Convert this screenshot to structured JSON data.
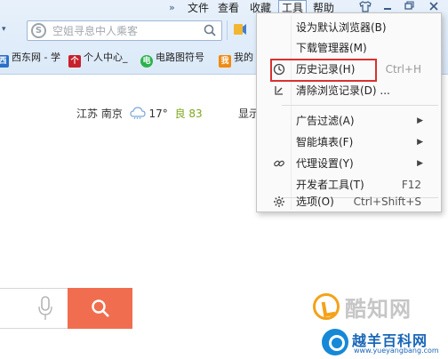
{
  "menubar": {
    "double_arrow": "»",
    "items": [
      "文件",
      "查看",
      "收藏",
      "工具",
      "帮助"
    ],
    "window_buttons": [
      "shirt-icon",
      "minimize-icon",
      "restore-icon",
      "close-icon"
    ]
  },
  "toolbar": {
    "search_placeholder": "空姐寻息中人乘客",
    "left_arrow": "▾"
  },
  "favorites": [
    {
      "label": "西东网 - 学",
      "icon": "xd-icon",
      "color": "#2a6fc9"
    },
    {
      "label": "个人中心_",
      "icon": "person-center-icon",
      "color": "#c8202d"
    },
    {
      "label": "电路图符号",
      "icon": "circuit-icon",
      "color": "#2bb24c"
    },
    {
      "label": "我的",
      "icon": "my-icon",
      "color": "#f08a12"
    }
  ],
  "page": {
    "weather": {
      "location": "江苏 南京",
      "temperature": "17°",
      "aqi_label": "良 83"
    },
    "cut_link": "显示"
  },
  "tools_menu": {
    "items": [
      {
        "label": "设为默认浏览器(B)",
        "shortcut": "",
        "submenu": false,
        "icon": ""
      },
      {
        "label": "下载管理器(M)",
        "shortcut": "",
        "submenu": false,
        "icon": ""
      },
      {
        "label": "历史记录(H)",
        "shortcut": "Ctrl+H",
        "submenu": false,
        "icon": "history-icon"
      },
      {
        "label": "清除浏览记录(D) ...",
        "shortcut": "",
        "submenu": false,
        "icon": "clear-history-icon"
      },
      {
        "label": "广告过滤(A)",
        "shortcut": "",
        "submenu": true,
        "icon": ""
      },
      {
        "label": "智能填表(F)",
        "shortcut": "",
        "submenu": true,
        "icon": ""
      },
      {
        "label": "代理设置(Y)",
        "shortcut": "",
        "submenu": true,
        "icon": "link-icon"
      },
      {
        "label": "开发者工具(T)",
        "shortcut": "F12",
        "submenu": false,
        "icon": ""
      },
      {
        "label": "选项(O)",
        "shortcut": "Ctrl+Shift+S",
        "submenu": false,
        "icon": "gear-icon"
      }
    ],
    "submenu_arrow": "▶",
    "highlighted_item": "历史记录(H)",
    "highlight_color": "#d8322f"
  },
  "watermarks": {
    "primary": "酷知网",
    "secondary": "越羊百科网",
    "secondary_url": "www.yueyangbang.com"
  },
  "colors": {
    "search_button": "#f06e4f",
    "aqi": "#7ea61a"
  }
}
